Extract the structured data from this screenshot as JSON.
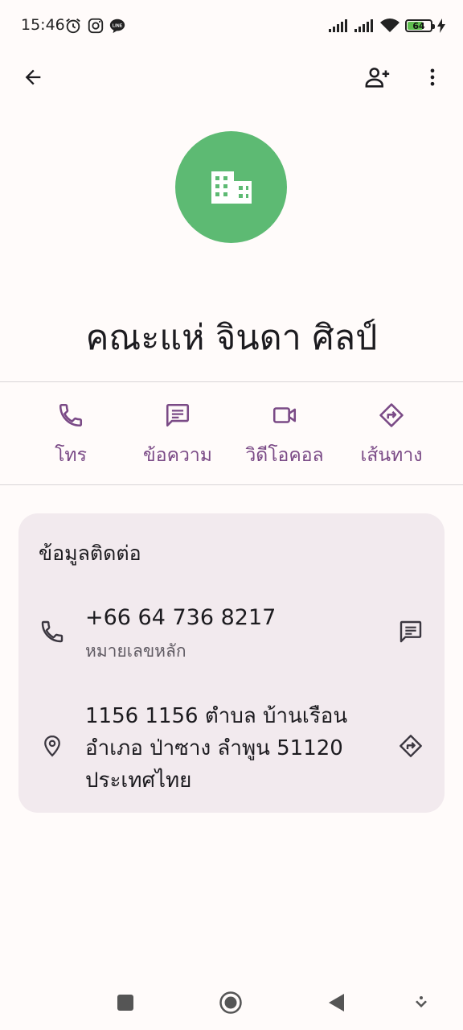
{
  "status_bar": {
    "time": "15:46",
    "battery_level": "64",
    "icons": [
      "alarm-icon",
      "instagram-icon",
      "line-icon",
      "signal-icon",
      "signal-icon",
      "wifi-icon",
      "battery-icon",
      "charging-icon"
    ]
  },
  "app_bar": {
    "icons": [
      "back-arrow-icon",
      "add-contact-icon",
      "more-vert-icon"
    ]
  },
  "contact": {
    "name": "คณะแห่ จินดา ศิลป์",
    "avatar_color": "#5dba73",
    "avatar_icon": "business-icon"
  },
  "actions": [
    {
      "label": "โทร",
      "icon": "phone-icon"
    },
    {
      "label": "ข้อความ",
      "icon": "message-icon"
    },
    {
      "label": "วิดีโอคอล",
      "icon": "videocam-icon"
    },
    {
      "label": "เส้นทาง",
      "icon": "directions-icon"
    }
  ],
  "details": {
    "title": "ข้อมูลติดต่อ",
    "phone": {
      "number": "+66 64 736 8217",
      "type": "หมายเลขหลัก"
    },
    "address": {
      "line1": "1156 1156 ตำบล บ้านเรือน",
      "line2": "อำเภอ ป่าซาง ลำพูน 51120",
      "line3": "ประเทศไทย"
    }
  },
  "nav_bar": {
    "icons": [
      "recents-icon",
      "home-icon",
      "back-icon",
      "keyboard-hide-icon"
    ]
  },
  "colors": {
    "accent": "#7a4a86",
    "background": "#fffbfa",
    "card": "#f2eaee"
  }
}
